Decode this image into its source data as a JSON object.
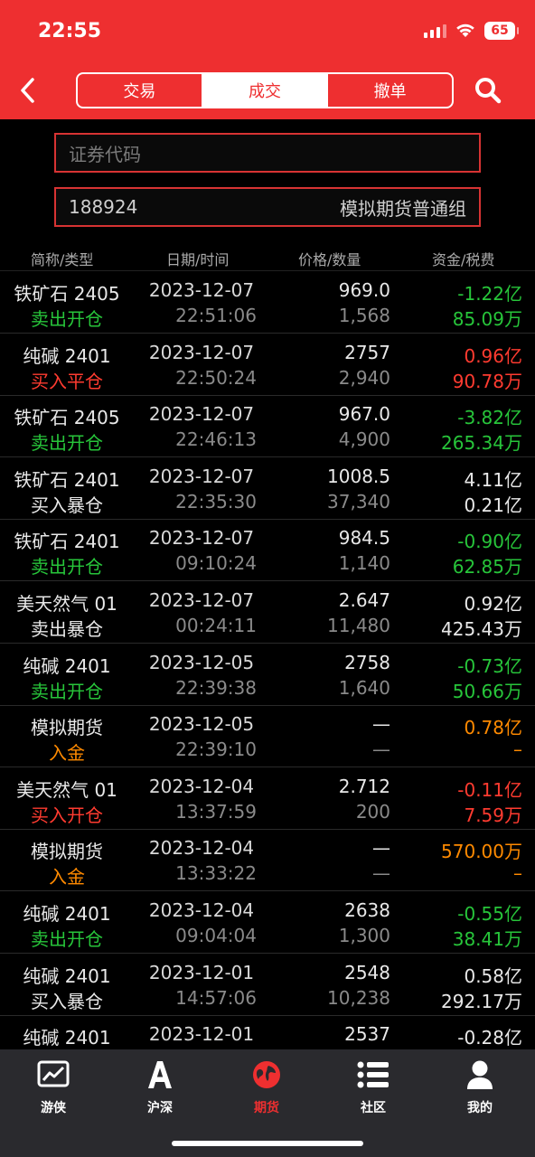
{
  "status_bar": {
    "time": "22:55",
    "battery": "65"
  },
  "header": {
    "tabs": [
      {
        "label": "交易",
        "active": false
      },
      {
        "label": "成交",
        "active": true
      },
      {
        "label": "撤单",
        "active": false
      }
    ]
  },
  "filters": {
    "code_placeholder": "证券代码",
    "account_id": "188924",
    "account_group": "模拟期货普通组"
  },
  "table": {
    "headers": [
      "简称/类型",
      "日期/时间",
      "价格/数量",
      "资金/税费"
    ],
    "rows": [
      {
        "name": "铁矿石 2405",
        "type": "卖出开仓",
        "date": "2023-12-07",
        "time": "22:51:06",
        "price": "969.0",
        "qty": "1,568",
        "amount": "-1.22亿",
        "fee": "85.09万",
        "type_color": "green",
        "amount_color": "green",
        "fee_color": "green"
      },
      {
        "name": "纯碱 2401",
        "type": "买入平仓",
        "date": "2023-12-07",
        "time": "22:50:24",
        "price": "2757",
        "qty": "2,940",
        "amount": "0.96亿",
        "fee": "90.78万",
        "type_color": "red",
        "amount_color": "red",
        "fee_color": "red"
      },
      {
        "name": "铁矿石 2405",
        "type": "卖出开仓",
        "date": "2023-12-07",
        "time": "22:46:13",
        "price": "967.0",
        "qty": "4,900",
        "amount": "-3.82亿",
        "fee": "265.34万",
        "type_color": "green",
        "amount_color": "green",
        "fee_color": "green"
      },
      {
        "name": "铁矿石 2401",
        "type": "买入暴仓",
        "date": "2023-12-07",
        "time": "22:35:30",
        "price": "1008.5",
        "qty": "37,340",
        "amount": "4.11亿",
        "fee": "0.21亿",
        "type_color": "white",
        "amount_color": "white",
        "fee_color": "white"
      },
      {
        "name": "铁矿石 2401",
        "type": "卖出开仓",
        "date": "2023-12-07",
        "time": "09:10:24",
        "price": "984.5",
        "qty": "1,140",
        "amount": "-0.90亿",
        "fee": "62.85万",
        "type_color": "green",
        "amount_color": "green",
        "fee_color": "green"
      },
      {
        "name": "美天然气 01",
        "type": "卖出暴仓",
        "date": "2023-12-07",
        "time": "00:24:11",
        "price": "2.647",
        "qty": "11,480",
        "amount": "0.92亿",
        "fee": "425.43万",
        "type_color": "white",
        "amount_color": "white",
        "fee_color": "white"
      },
      {
        "name": "纯碱 2401",
        "type": "卖出开仓",
        "date": "2023-12-05",
        "time": "22:39:38",
        "price": "2758",
        "qty": "1,640",
        "amount": "-0.73亿",
        "fee": "50.66万",
        "type_color": "green",
        "amount_color": "green",
        "fee_color": "green"
      },
      {
        "name": "模拟期货",
        "type": "入金",
        "date": "2023-12-05",
        "time": "22:39:10",
        "price": "—",
        "qty": "—",
        "amount": "0.78亿",
        "fee": "–",
        "type_color": "orange",
        "amount_color": "orange",
        "fee_color": "orange"
      },
      {
        "name": "美天然气 01",
        "type": "买入开仓",
        "date": "2023-12-04",
        "time": "13:37:59",
        "price": "2.712",
        "qty": "200",
        "amount": "-0.11亿",
        "fee": "7.59万",
        "type_color": "red",
        "amount_color": "red",
        "fee_color": "red"
      },
      {
        "name": "模拟期货",
        "type": "入金",
        "date": "2023-12-04",
        "time": "13:33:22",
        "price": "—",
        "qty": "—",
        "amount": "570.00万",
        "fee": "–",
        "type_color": "orange",
        "amount_color": "orange",
        "fee_color": "orange"
      },
      {
        "name": "纯碱 2401",
        "type": "卖出开仓",
        "date": "2023-12-04",
        "time": "09:04:04",
        "price": "2638",
        "qty": "1,300",
        "amount": "-0.55亿",
        "fee": "38.41万",
        "type_color": "green",
        "amount_color": "green",
        "fee_color": "green"
      },
      {
        "name": "纯碱 2401",
        "type": "买入暴仓",
        "date": "2023-12-01",
        "time": "14:57:06",
        "price": "2548",
        "qty": "10,238",
        "amount": "0.58亿",
        "fee": "292.17万",
        "type_color": "white",
        "amount_color": "white",
        "fee_color": "white"
      },
      {
        "name": "纯碱 2401",
        "type": "",
        "date": "2023-12-01",
        "time": "",
        "price": "2537",
        "qty": "",
        "amount": "-0.28亿",
        "fee": "",
        "type_color": "white",
        "amount_color": "white",
        "fee_color": "white"
      }
    ]
  },
  "tabbar": {
    "items": [
      {
        "label": "游侠",
        "icon": "chart-line-icon",
        "active": false
      },
      {
        "label": "沪深",
        "icon": "letter-a-icon",
        "active": false
      },
      {
        "label": "期货",
        "icon": "globe-icon",
        "active": true
      },
      {
        "label": "社区",
        "icon": "list-icon",
        "active": false
      },
      {
        "label": "我的",
        "icon": "person-icon",
        "active": false
      }
    ]
  },
  "colors": {
    "accent": "#ee2f30",
    "up": "#ff3b30",
    "down": "#27c53a",
    "deposit": "#ff8a00"
  }
}
